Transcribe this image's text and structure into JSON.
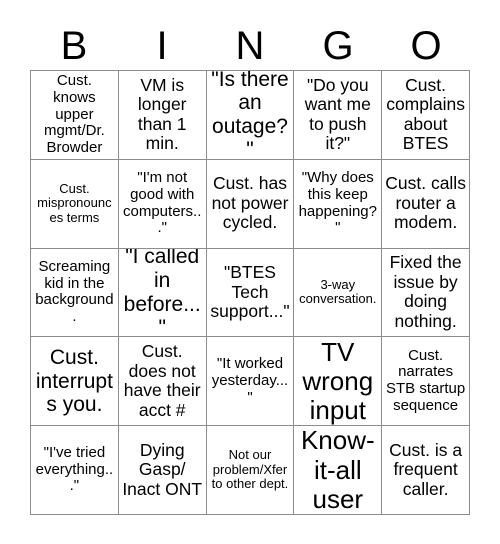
{
  "header": {
    "letters": [
      "B",
      "I",
      "N",
      "G",
      "O"
    ]
  },
  "grid": {
    "rows": 5,
    "columns": 5,
    "border_color": "#8c8c8c",
    "background_color": "#ffffff",
    "text_color": "#000000",
    "cells": [
      {
        "text": "Cust. knows upper mgmt/Dr. Browder",
        "size": "fs-m"
      },
      {
        "text": "VM is longer than 1 min.",
        "size": "fs-l"
      },
      {
        "text": "\"Is there an outage?\"",
        "size": "fs-xl"
      },
      {
        "text": "\"Do you want me to push it?\"",
        "size": "fs-l"
      },
      {
        "text": "Cust. complains about BTES",
        "size": "fs-l"
      },
      {
        "text": "Cust. mispronounces terms",
        "size": "fs-s"
      },
      {
        "text": "\"I'm not good with computers...\"",
        "size": "fs-m"
      },
      {
        "text": "Cust. has not power cycled.",
        "size": "fs-l"
      },
      {
        "text": "\"Why does this keep happening?\"",
        "size": "fs-m"
      },
      {
        "text": "Cust. calls router a modem.",
        "size": "fs-l"
      },
      {
        "text": "Screaming kid in the background.",
        "size": "fs-m"
      },
      {
        "text": "\"I called in before...\"",
        "size": "fs-xl"
      },
      {
        "text": "\"BTES Tech support...\"",
        "size": "fs-l"
      },
      {
        "text": "3-way conversation.",
        "size": "fs-s"
      },
      {
        "text": "Fixed the issue by doing nothing.",
        "size": "fs-l"
      },
      {
        "text": "Cust. interrupts you.",
        "size": "fs-xl"
      },
      {
        "text": "Cust. does not have their acct #",
        "size": "fs-l"
      },
      {
        "text": "\"It worked yesterday...\"",
        "size": "fs-m"
      },
      {
        "text": "TV wrong input",
        "size": "fs-xxl"
      },
      {
        "text": "Cust. narrates STB startup sequence",
        "size": "fs-m"
      },
      {
        "text": "\"I've tried everything...\"",
        "size": "fs-m"
      },
      {
        "text": "Dying Gasp/ Inact ONT",
        "size": "fs-l"
      },
      {
        "text": "Not our problem/Xfer to other dept.",
        "size": "fs-s"
      },
      {
        "text": "Know-it-all user",
        "size": "fs-xxl"
      },
      {
        "text": "Cust. is a frequent caller.",
        "size": "fs-l"
      }
    ]
  }
}
